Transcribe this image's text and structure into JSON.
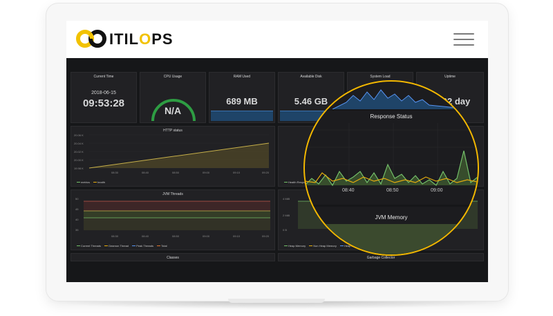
{
  "brand": {
    "prefix": "ITIL",
    "o": "O",
    "suffix": "PS"
  },
  "colors": {
    "accent": "#f2c200",
    "green": "#73bf69",
    "yellow": "#e5ac0e",
    "blue": "#5794f2",
    "dash_bg": "#161719",
    "panel_bg": "#212124"
  },
  "stats": {
    "current_time": {
      "title": "Current Time",
      "date": "2018-06-15",
      "time": "09:53:28"
    },
    "cpu": {
      "title": "CPU Usage",
      "value": "N/A"
    },
    "ram": {
      "title": "RAM Used",
      "value": "689 MB"
    },
    "disk": {
      "title": "Available Disk",
      "value": "5.46 GB"
    },
    "load": {
      "title": "System Load"
    },
    "uptime": {
      "title": "Uptime",
      "value": "13.92 day"
    }
  },
  "http": {
    "title": "HTTP status",
    "yticks": [
      "20.06 K",
      "20.04 K",
      "20.02 K",
      "20.00 K",
      "19.98 K"
    ],
    "xticks": [
      "08:30",
      "08:40",
      "08:50",
      "09:00",
      "09:10",
      "09:20"
    ],
    "legend": [
      "metrics",
      "health"
    ]
  },
  "response": {
    "title": "Response Status",
    "xticks": [
      "08:40",
      "08:50",
      "09:00"
    ],
    "legend": [
      "Health Response"
    ]
  },
  "jvm_threads": {
    "title": "JVM Threads",
    "yticks": [
      "50",
      "45",
      "40",
      "35"
    ],
    "xticks": [
      "08:30",
      "08:40",
      "08:50",
      "09:00",
      "09:10",
      "09:20"
    ],
    "legend": [
      "Current Threads",
      "Deamon Thread",
      "Peak Threads",
      "Total"
    ]
  },
  "jvm_memory": {
    "title": "JVM Memory",
    "yticks": [
      "4 MiB",
      "2 MiB",
      "0 B"
    ],
    "legend": [
      "Heap Memory",
      "Non Heap Memory",
      "Heap Memory Used",
      "Non Heap Memory Used"
    ]
  },
  "bottom": {
    "classes": "Classes",
    "gc": "Garbage Collector"
  }
}
